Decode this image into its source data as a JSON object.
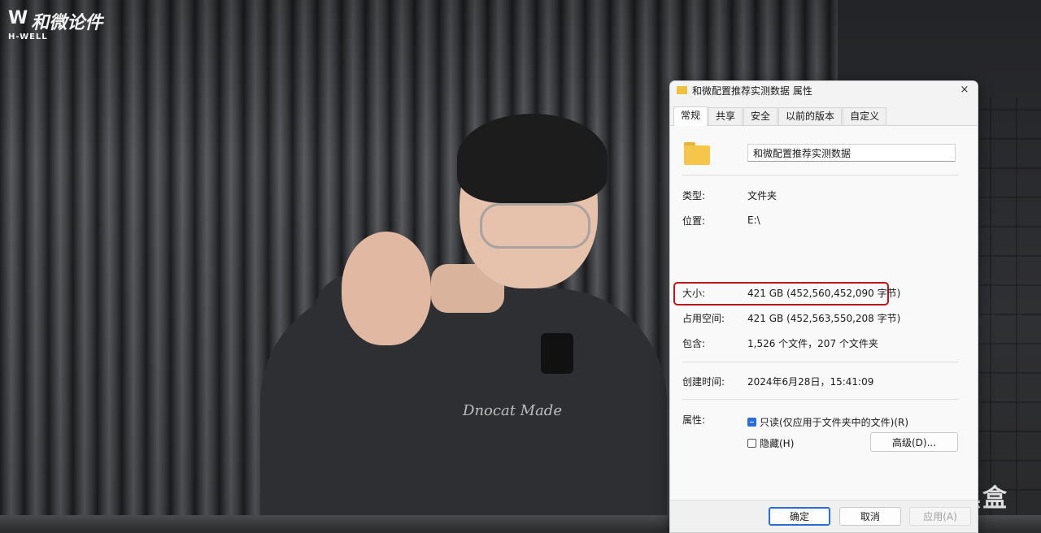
{
  "video": {
    "logo": {
      "mark": "W",
      "brand": "和微论件",
      "sub": "H-WELL"
    },
    "shirt_print": "Dnocat Made",
    "watermark": "小黑盒"
  },
  "dialog": {
    "title": "和微配置推荐实测数据 属性",
    "close_label": "×",
    "tabs": [
      {
        "label": "常规",
        "active": true
      },
      {
        "label": "共享",
        "active": false
      },
      {
        "label": "安全",
        "active": false
      },
      {
        "label": "以前的版本",
        "active": false
      },
      {
        "label": "自定义",
        "active": false
      }
    ],
    "folder_name": "和微配置推荐实测数据",
    "properties": {
      "type": {
        "label": "类型:",
        "value": "文件夹"
      },
      "location": {
        "label": "位置:",
        "value": "E:\\"
      },
      "size": {
        "label": "大小:",
        "value": "421 GB (452,560,452,090 字节)"
      },
      "disk_size": {
        "label": "占用空间:",
        "value": "421 GB (452,563,550,208 字节)"
      },
      "contains": {
        "label": "包含:",
        "value": "1,526 个文件，207 个文件夹"
      },
      "created": {
        "label": "创建时间:",
        "value": "2024年6月28日，15:41:09"
      }
    },
    "attributes": {
      "label": "属性:",
      "readonly": {
        "label": "只读(仅应用于文件夹中的文件)(R)",
        "state": "indeterminate"
      },
      "hidden": {
        "label": "隐藏(H)",
        "state": "unchecked"
      },
      "advanced_label": "高级(D)..."
    },
    "buttons": {
      "ok": "确定",
      "cancel": "取消",
      "apply": "应用(A)"
    },
    "colors": {
      "highlight_border": "#c0141d",
      "accent": "#2a6dd8",
      "folder": "#f6c64a"
    }
  }
}
